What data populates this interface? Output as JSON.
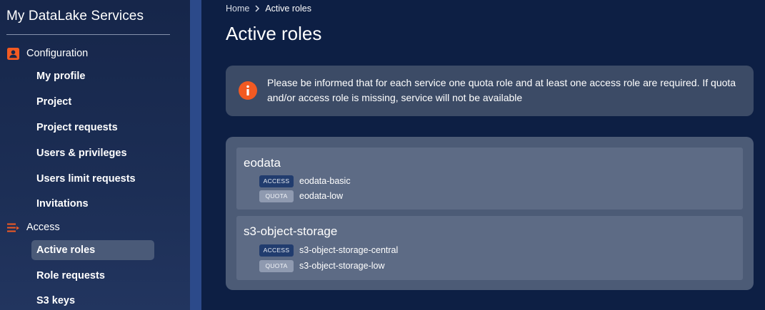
{
  "sidebar": {
    "app_title": "My DataLake Services",
    "sections": [
      {
        "label": "Configuration",
        "icon": "person-badge-icon"
      },
      {
        "label": "Access",
        "icon": "list-icon"
      }
    ],
    "config_items": [
      "My profile",
      "Project",
      "Project requests",
      "Users & privileges",
      "Users limit requests",
      "Invitations"
    ],
    "access_items": [
      "Active roles",
      "Role requests",
      "S3 keys"
    ],
    "active_item": "Active roles"
  },
  "breadcrumb": {
    "home": "Home",
    "current": "Active roles"
  },
  "page": {
    "title": "Active roles"
  },
  "info": {
    "icon": "info-icon",
    "text": "Please be informed that for each service one quota role and at least one access role are required. If quota and/or access role is missing, service will not be available"
  },
  "services": [
    {
      "name": "eodata",
      "roles": [
        {
          "type": "ACCESS",
          "name": "eodata-basic"
        },
        {
          "type": "QUOTA",
          "name": "eodata-low"
        }
      ]
    },
    {
      "name": "s3-object-storage",
      "roles": [
        {
          "type": "ACCESS",
          "name": "s3-object-storage-central"
        },
        {
          "type": "QUOTA",
          "name": "s3-object-storage-low"
        }
      ]
    }
  ],
  "colors": {
    "background": "#0d1f44",
    "accent_orange": "#f25a22",
    "access_badge": "#213c6e",
    "quota_badge": "#8f9ab0",
    "active_nav": "#4a5a78"
  }
}
